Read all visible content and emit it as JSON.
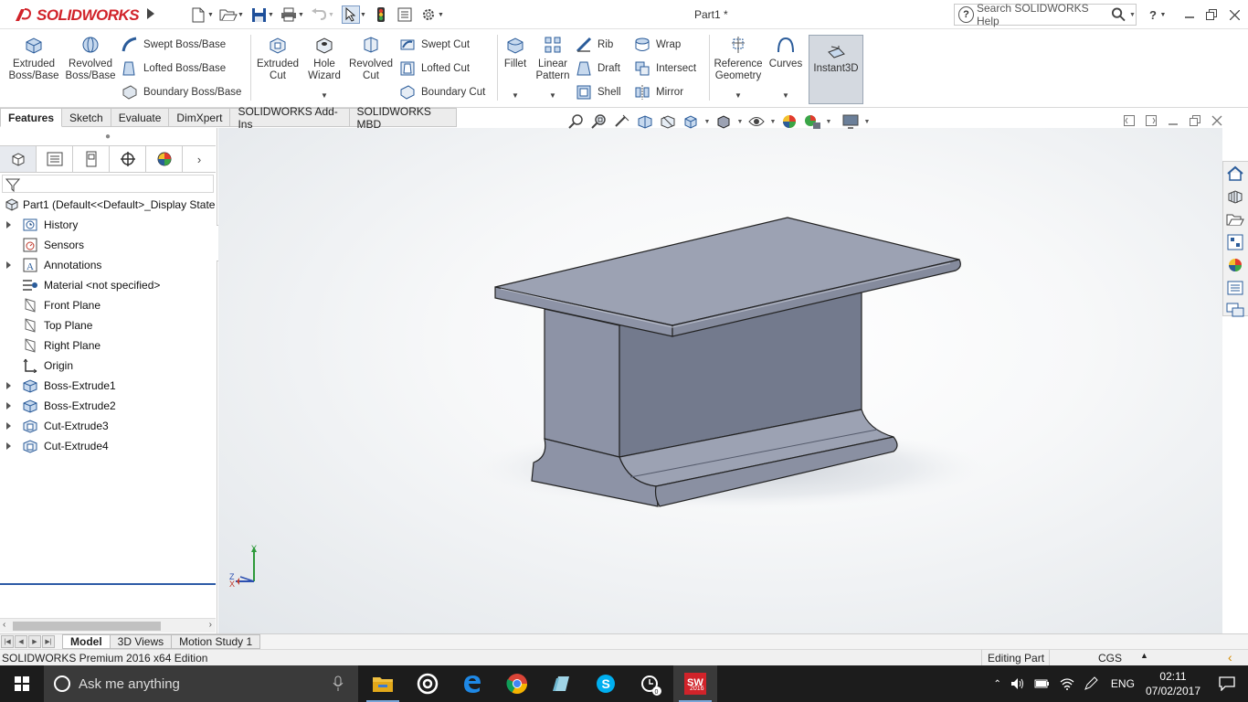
{
  "app": {
    "logo_text": "SOLIDWORKS",
    "document_title": "Part1 *",
    "search_placeholder": "Search SOLIDWORKS Help",
    "help_label": "?"
  },
  "command_manager": {
    "extruded_boss": "Extruded\nBoss/Base",
    "revolved_boss": "Revolved\nBoss/Base",
    "swept_boss": "Swept Boss/Base",
    "lofted_boss": "Lofted Boss/Base",
    "boundary_boss": "Boundary Boss/Base",
    "extruded_cut": "Extruded\nCut",
    "hole_wizard": "Hole\nWizard",
    "revolved_cut": "Revolved\nCut",
    "swept_cut": "Swept Cut",
    "lofted_cut": "Lofted Cut",
    "boundary_cut": "Boundary Cut",
    "fillet": "Fillet",
    "linear_pattern": "Linear\nPattern",
    "rib": "Rib",
    "draft": "Draft",
    "shell": "Shell",
    "wrap": "Wrap",
    "intersect": "Intersect",
    "mirror": "Mirror",
    "reference_geometry": "Reference\nGeometry",
    "curves": "Curves",
    "instant3d": "Instant3D"
  },
  "tabs": [
    "Features",
    "Sketch",
    "Evaluate",
    "DimXpert",
    "SOLIDWORKS Add-Ins",
    "SOLIDWORKS MBD"
  ],
  "tree": {
    "root": "Part1  (Default<<Default>_Display State",
    "items": [
      {
        "label": "History",
        "expandable": true,
        "icon": "history-icon"
      },
      {
        "label": "Sensors",
        "expandable": false,
        "icon": "sensors-icon"
      },
      {
        "label": "Annotations",
        "expandable": true,
        "icon": "annotations-icon"
      },
      {
        "label": "Material <not specified>",
        "expandable": false,
        "icon": "material-icon"
      },
      {
        "label": "Front Plane",
        "expandable": false,
        "icon": "plane-icon"
      },
      {
        "label": "Top Plane",
        "expandable": false,
        "icon": "plane-icon"
      },
      {
        "label": "Right Plane",
        "expandable": false,
        "icon": "plane-icon"
      },
      {
        "label": "Origin",
        "expandable": false,
        "icon": "origin-icon"
      },
      {
        "label": "Boss-Extrude1",
        "expandable": true,
        "icon": "boss-extrude-icon"
      },
      {
        "label": "Boss-Extrude2",
        "expandable": true,
        "icon": "boss-extrude-icon"
      },
      {
        "label": "Cut-Extrude3",
        "expandable": true,
        "icon": "cut-extrude-icon"
      },
      {
        "label": "Cut-Extrude4",
        "expandable": true,
        "icon": "cut-extrude-icon"
      }
    ]
  },
  "bottom_tabs": [
    "Model",
    "3D Views",
    "Motion Study 1"
  ],
  "status": {
    "edition": "SOLIDWORKS Premium 2016 x64 Edition",
    "mode": "Editing Part",
    "units": "CGS"
  },
  "triad": {
    "y": "Y",
    "z": "Z",
    "x": "X"
  },
  "taskbar": {
    "search_placeholder": "Ask me anything",
    "language": "ENG",
    "time": "02:11",
    "date": "07/02/2017",
    "sw_badge": "2016"
  },
  "colors": {
    "brand": "#d1232a",
    "part_face": "#8d93a6",
    "accent": "#2c5aa6"
  }
}
